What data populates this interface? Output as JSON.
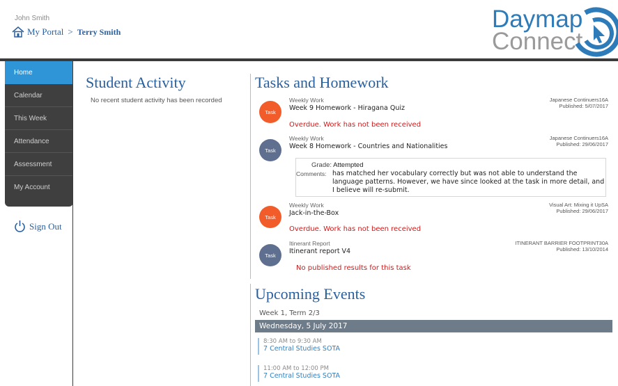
{
  "header": {
    "user_name": "John Smith",
    "portal_label": "My Portal",
    "separator": ">",
    "current_student": "Terry Smith"
  },
  "logo": {
    "line1": "Daymap",
    "line2": "Connect"
  },
  "sidebar": {
    "items": [
      {
        "label": "Home",
        "active": true
      },
      {
        "label": "Calendar",
        "active": false
      },
      {
        "label": "This Week",
        "active": false
      },
      {
        "label": "Attendance",
        "active": false
      },
      {
        "label": "Assessment",
        "active": false
      },
      {
        "label": "My Account",
        "active": false
      }
    ],
    "signout_label": "Sign Out"
  },
  "activity": {
    "title": "Student Activity",
    "empty_message": "No recent student activity has been recorded"
  },
  "tasks": {
    "title": "Tasks and Homework",
    "items": [
      {
        "badge": "Task",
        "badge_color": "#f25c2a",
        "type": "Weekly Work",
        "name": "Week 9 Homework - Hiragana Quiz",
        "class_name": "Japanese Continuers16A",
        "published": "Published: 5/07/2017",
        "status": "Overdue. Work has not been received"
      },
      {
        "badge": "Task",
        "badge_color": "#5f6f8f",
        "type": "Weekly Work",
        "name": "Week 8 Homework - Countries and Nationalities",
        "class_name": "Japanese Continuers16A",
        "published": "Published: 29/06/2017",
        "grade_label": "Grade:",
        "grade_value": "Attempted",
        "comments_label": "Comments:",
        "comments": "has matched her vocabulary correctly but was not able to understand the language patterns. However, we have since looked at the task in more detail, and I believe will re-submit."
      },
      {
        "badge": "Task",
        "badge_color": "#f25c2a",
        "type": "Weekly Work",
        "name": "Jack-in-the-Box",
        "class_name": "Visual Art: Mixing it UpSA",
        "published": "Published: 29/06/2017",
        "status": "Overdue. Work has not been received"
      },
      {
        "badge": "Task",
        "badge_color": "#5f6f8f",
        "type": "Itinerant Report",
        "name": "Itinerant report V4",
        "class_name": "ITINERANT BARRIER FOOTPRINT30A",
        "published": "Published: 13/10/2014",
        "status": "No published results for this task"
      }
    ]
  },
  "events": {
    "title": "Upcoming Events",
    "week_label": "Week 1, Term 2/3",
    "day_label": "Wednesday, 5 July 2017",
    "items": [
      {
        "time": "8:30 AM to 9:30 AM",
        "name": "7 Central Studies SOTA"
      },
      {
        "time": "11:00 AM to 12:00 PM",
        "name": "7 Central Studies SOTA"
      }
    ]
  },
  "colors": {
    "accent": "#2a5f9e",
    "nav_active": "#2f95d6",
    "overdue": "#cc1a1a",
    "badge_orange": "#f25c2a",
    "badge_slate": "#5f6f8f"
  }
}
